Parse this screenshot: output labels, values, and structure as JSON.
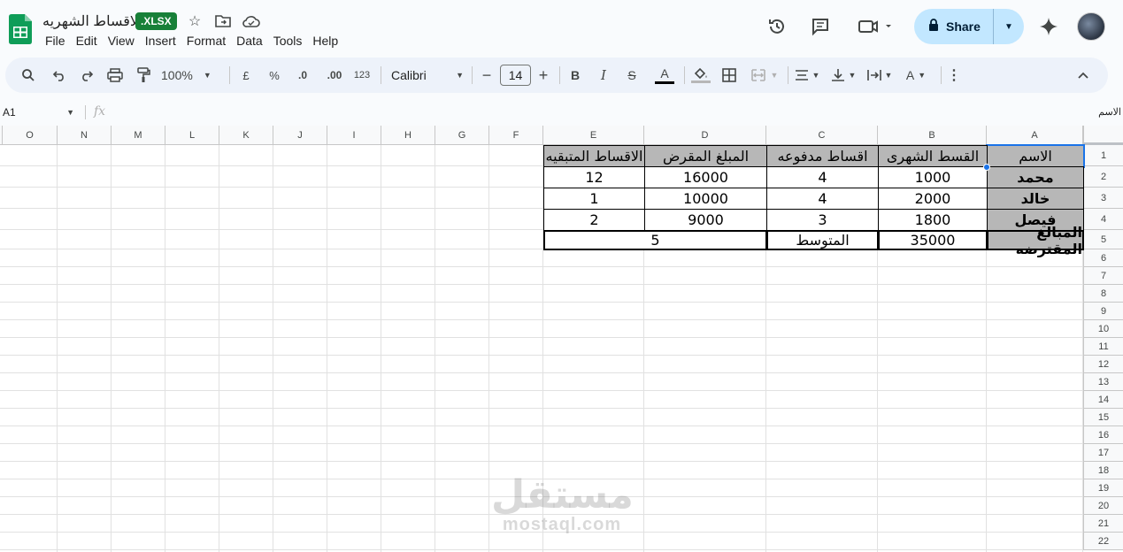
{
  "title_bar": {
    "doc_title": "الاقساط الشهريه",
    "badge": ".XLSX",
    "share_label": "Share"
  },
  "menu": [
    "File",
    "Edit",
    "View",
    "Insert",
    "Format",
    "Data",
    "Tools",
    "Help"
  ],
  "toolbar": {
    "zoom": "100%",
    "currency": "£",
    "percent": "%",
    "dec_decrease": ".0",
    "dec_increase": ".00",
    "number_format": "123",
    "font": "Calibri",
    "font_size": "14"
  },
  "formula_bar": {
    "cell_ref": "A1",
    "fx": "fx",
    "content": "الاسم"
  },
  "sheet": {
    "columns": [
      "O",
      "N",
      "M",
      "L",
      "K",
      "J",
      "I",
      "H",
      "G",
      "F",
      "E",
      "D",
      "C",
      "B",
      "A"
    ],
    "rows": [
      "1",
      "2",
      "3",
      "4",
      "5",
      "6",
      "7",
      "8",
      "9",
      "10",
      "11",
      "12",
      "13",
      "14",
      "15",
      "16",
      "17",
      "18",
      "19",
      "20",
      "21",
      "22"
    ],
    "header": {
      "A": "الاسم",
      "B": "القسط الشهرى",
      "C": "اقساط مدفوعه",
      "D": "المبلغ المقرض",
      "E": "الاقساط المتبقيه"
    },
    "data": [
      {
        "A": "محمد",
        "B": "1000",
        "C": "4",
        "D": "16000",
        "E": "12"
      },
      {
        "A": "خالد",
        "B": "2000",
        "C": "4",
        "D": "10000",
        "E": "1"
      },
      {
        "A": "فيصل",
        "B": "1800",
        "C": "3",
        "D": "9000",
        "E": "2"
      }
    ],
    "summary": {
      "A": "المبالغ المقترضه",
      "B": "35000",
      "C": "المتوسط",
      "DE": "5"
    }
  },
  "watermark": {
    "arabic": "مستقل",
    "latin": "mostaql.com"
  }
}
